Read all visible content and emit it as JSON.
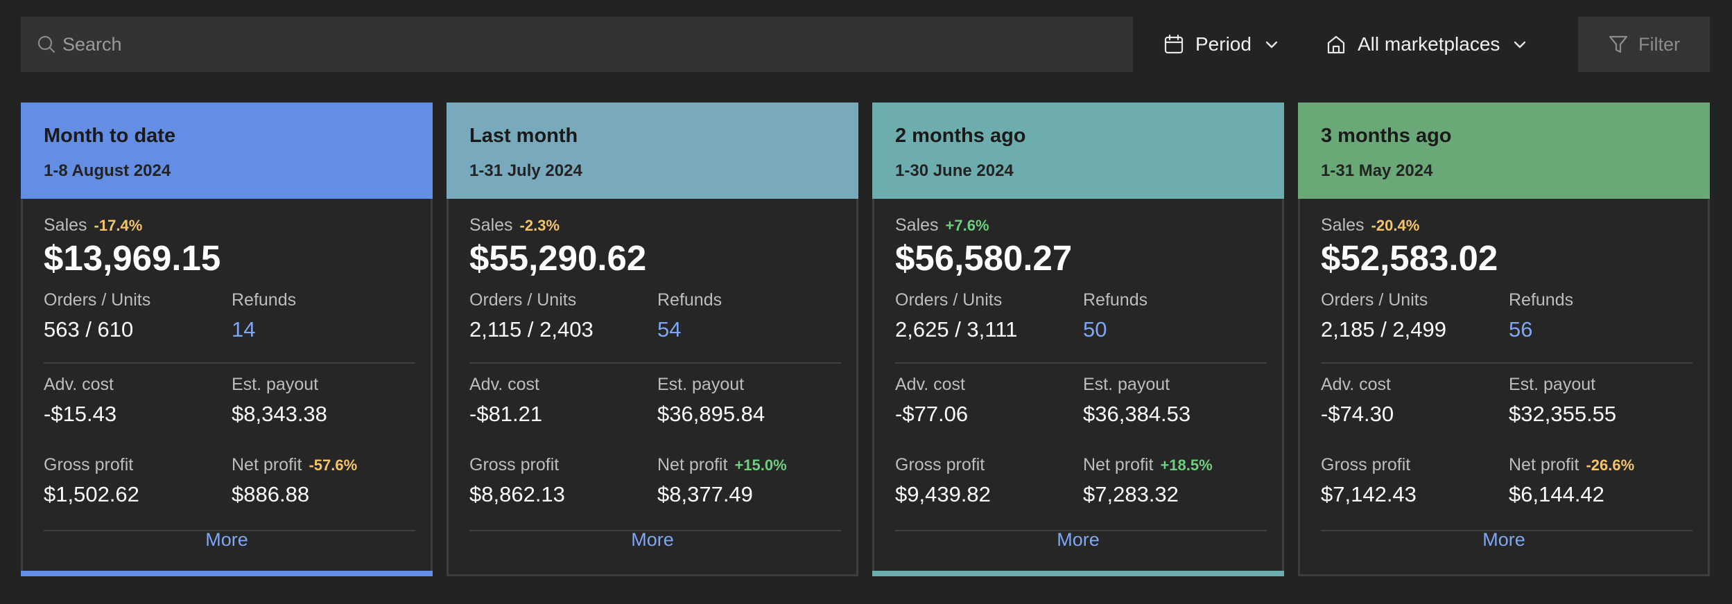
{
  "search": {
    "placeholder": "Search"
  },
  "filters": {
    "period_label": "Period",
    "marketplace_label": "All marketplaces",
    "filter_label": "Filter"
  },
  "labels": {
    "sales": "Sales",
    "orders_units": "Orders / Units",
    "refunds": "Refunds",
    "adv_cost": "Adv. cost",
    "est_payout": "Est. payout",
    "gross_profit": "Gross profit",
    "net_profit": "Net profit",
    "more": "More"
  },
  "colors": {
    "negative_change": "#f5c36a",
    "positive_change": "#6fcf7f",
    "link": "#7fa6f2"
  },
  "cards": [
    {
      "title": "Month to date",
      "subtitle": "1-8 August 2024",
      "header_color": "#648de4",
      "sales": "$13,969.15",
      "sales_change": "-17.4%",
      "orders_units": "563 / 610",
      "refunds": "14",
      "adv_cost": "-$15.43",
      "est_payout": "$8,343.38",
      "gross_profit": "$1,502.62",
      "net_profit": "$886.88",
      "net_profit_change": "-57.6%",
      "accent_color": "#648de4"
    },
    {
      "title": "Last month",
      "subtitle": "1-31 July 2024",
      "header_color": "#78a9bd",
      "sales": "$55,290.62",
      "sales_change": "-2.3%",
      "orders_units": "2,115 / 2,403",
      "refunds": "54",
      "adv_cost": "-$81.21",
      "est_payout": "$36,895.84",
      "gross_profit": "$8,862.13",
      "net_profit": "$8,377.49",
      "net_profit_change": "+15.0%",
      "accent_color": ""
    },
    {
      "title": "2 months ago",
      "subtitle": "1-30 June 2024",
      "header_color": "#6eadad",
      "sales": "$56,580.27",
      "sales_change": "+7.6%",
      "orders_units": "2,625 / 3,111",
      "refunds": "50",
      "adv_cost": "-$77.06",
      "est_payout": "$36,384.53",
      "gross_profit": "$9,439.82",
      "net_profit": "$7,283.32",
      "net_profit_change": "+18.5%",
      "accent_color": "#6eadad"
    },
    {
      "title": "3 months ago",
      "subtitle": "1-31 May 2024",
      "header_color": "#6aa878",
      "sales": "$52,583.02",
      "sales_change": "-20.4%",
      "orders_units": "2,185 / 2,499",
      "refunds": "56",
      "adv_cost": "-$74.30",
      "est_payout": "$32,355.55",
      "gross_profit": "$7,142.43",
      "net_profit": "$6,144.42",
      "net_profit_change": "-26.6%",
      "accent_color": ""
    }
  ]
}
